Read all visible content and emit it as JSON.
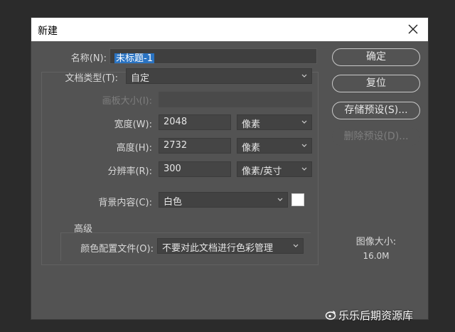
{
  "dialog": {
    "title": "新建",
    "labels": {
      "name": "名称(N):",
      "doc_type": "文档类型(T):",
      "canvas_size": "画板大小(I):",
      "width": "宽度(W):",
      "height": "高度(H):",
      "resolution": "分辨率(R):",
      "background": "背景内容(C):",
      "advanced": "高级",
      "color_profile": "颜色配置文件(O):"
    },
    "values": {
      "name": "未标题-1",
      "doc_type": "自定",
      "canvas_size": "",
      "width": "2048",
      "width_unit": "像素",
      "height": "2732",
      "height_unit": "像素",
      "resolution": "300",
      "resolution_unit": "像素/英寸",
      "background": "白色",
      "color_profile": "不要对此文档进行色彩管理"
    },
    "buttons": {
      "ok": "确定",
      "reset": "复位",
      "save_preset": "存储预设(S)...",
      "delete_preset": "删除预设(D)..."
    },
    "image_size": {
      "label": "图像大小:",
      "value": "16.0M"
    },
    "colors": {
      "selection": "#2a73c2",
      "background_swatch": "#ffffff"
    }
  },
  "watermark": {
    "text": "乐乐后期资源库",
    "icon": "weibo-like-icon"
  }
}
